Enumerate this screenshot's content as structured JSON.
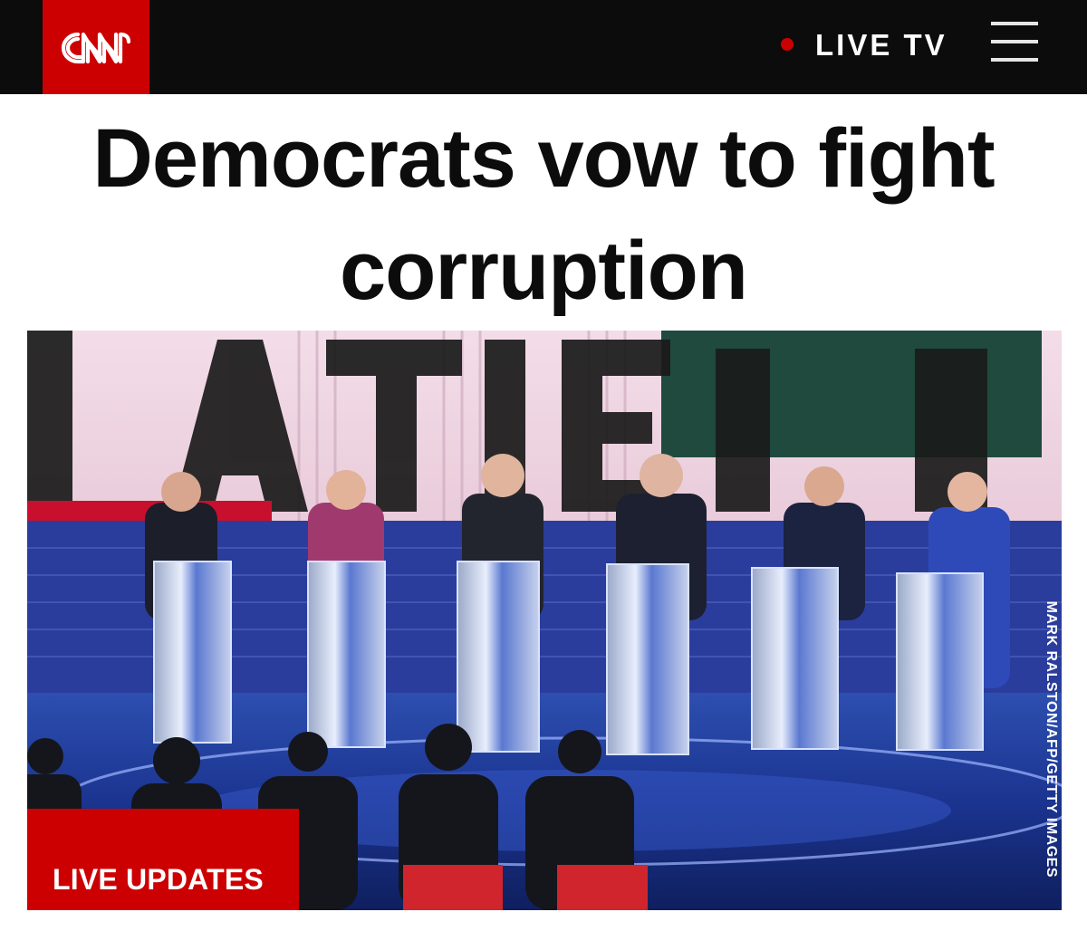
{
  "header": {
    "logo_text": "CNN",
    "live_label": "LIVE TV",
    "menu_icon": "hamburger-menu-icon",
    "brand_color": "#cc0000",
    "bar_color": "#0c0c0c"
  },
  "article": {
    "headline": "Democrats vow to fight corruption",
    "image": {
      "credit": "MARK RALSTON/AFP/GETTY IMAGES",
      "backdrop_letters": "BATE DE",
      "badge_label": "LIVE UPDATES"
    }
  }
}
